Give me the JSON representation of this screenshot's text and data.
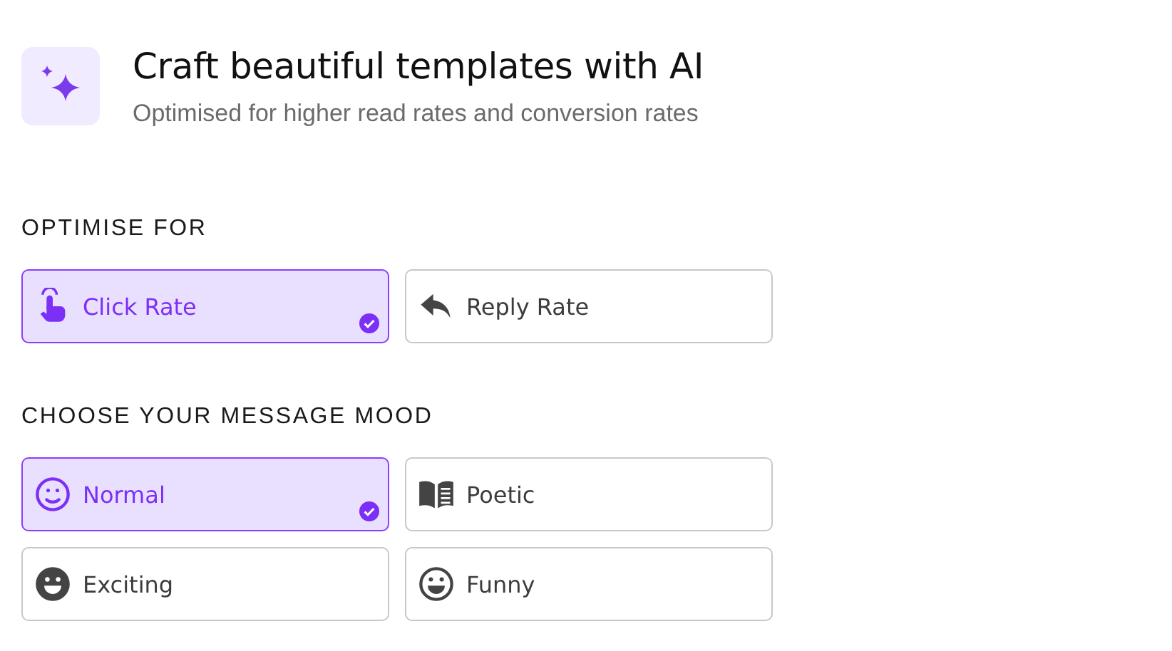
{
  "header": {
    "title": "Craft beautiful templates with AI",
    "subtitle": "Optimised for higher read rates and conversion rates"
  },
  "sections": [
    {
      "label": "OPTIMISE FOR",
      "options": [
        {
          "label": "Click Rate",
          "kind": "pointer",
          "selected": true
        },
        {
          "label": "Reply Rate",
          "kind": "reply",
          "selected": false
        }
      ]
    },
    {
      "label": "CHOOSE YOUR MESSAGE MOOD",
      "options": [
        {
          "label": "Normal",
          "kind": "smile",
          "selected": true
        },
        {
          "label": "Poetic",
          "kind": "book",
          "selected": false
        },
        {
          "label": "Exciting",
          "kind": "grin-solid",
          "selected": false
        },
        {
          "label": "Funny",
          "kind": "grin",
          "selected": false
        }
      ]
    }
  ]
}
